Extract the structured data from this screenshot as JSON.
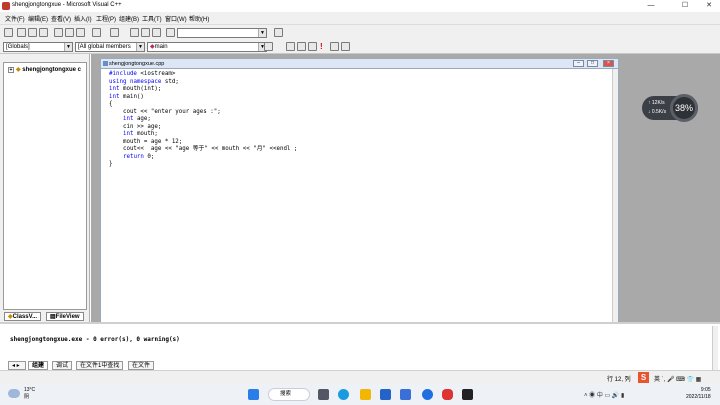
{
  "window": {
    "title": "shengjongtongxue - Microsoft Visual C++",
    "minimize": "—",
    "maximize": "☐",
    "close": "✕"
  },
  "menu": [
    "文件(F)",
    "编辑(E)",
    "查看(V)",
    "插入(I)",
    "工程(P)",
    "组建(B)",
    "工具(T)",
    "窗口(W)",
    "帮助(H)"
  ],
  "toolbar2": {
    "globals_combo": "[Globals]",
    "members_combo": "[All global members",
    "function_combo": "main"
  },
  "workspace": {
    "tree_root": "shengjongtongxue c",
    "tabs": [
      "ClassV...",
      "FileView"
    ]
  },
  "editor": {
    "title": "shengjongtongxue.cpp",
    "code_lines": [
      "#include <iostream>",
      "using namespace std;",
      "int mouth(int);",
      "int main()",
      "{",
      "    cout << \"enter your ages :\";",
      "    int age;",
      "    cin >> age;",
      "    int mouth;",
      "    mouth = age * 12;",
      "    cout<<  age << \"age 等于\" << mouth << \"月\" <<endl ;",
      "    return 0;",
      "}"
    ]
  },
  "output": {
    "message": "shengjongtongxue.exe - 0 error(s), 0 warning(s)",
    "tabs": [
      "组建",
      "调试",
      "在文件1中查找",
      "在文件"
    ]
  },
  "status": {
    "position": "行 12, 列"
  },
  "perf_widget": {
    "up": "↑ 12K/s",
    "down": "↓ 0.5K/s",
    "percent": "38%"
  },
  "taskbar": {
    "weather_temp": "13°C",
    "weather_desc": "阴",
    "search_label": "搜索",
    "time": "9:05",
    "date": "2022/11/18"
  }
}
